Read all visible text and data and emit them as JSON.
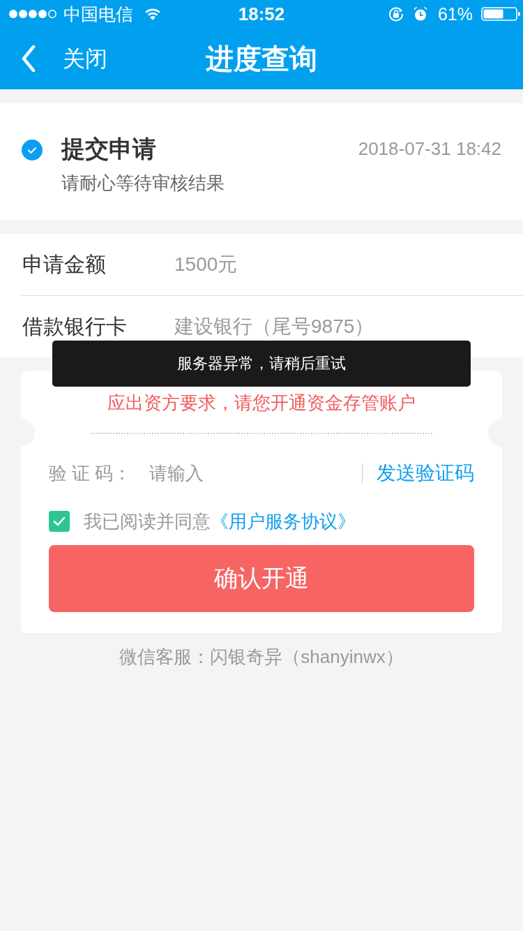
{
  "status_bar": {
    "carrier": "中国电信",
    "time": "18:52",
    "battery": "61%"
  },
  "nav_bar": {
    "back_label": "关闭",
    "title": "进度查询"
  },
  "progress": {
    "done": true,
    "title": "提交申请",
    "time": "2018-07-31 18:42",
    "note": "请耐心等待审核结果"
  },
  "details": [
    {
      "label": "申请金额",
      "value": "1500元"
    },
    {
      "label": "借款银行卡",
      "value": "建设银行（尾号9875）"
    }
  ],
  "toast": {
    "message": "服务器异常，请稍后重试"
  },
  "dialog": {
    "notice": "应出资方要求，请您开通资金存管账户",
    "code_field": {
      "label": "验 证 码：",
      "placeholder": "请输入"
    },
    "send_button": "发送验证码",
    "agreement": {
      "checked": true,
      "text": "我已阅读并同意",
      "link": "《用户服务协议》"
    },
    "confirm_button": "确认开通"
  },
  "footer": "微信客服：闪银奇异（shanyinwx）"
}
